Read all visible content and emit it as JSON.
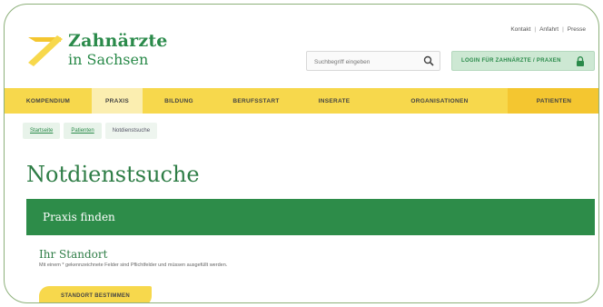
{
  "logo": {
    "title": "Zahnärzte",
    "subtitle": "in Sachsen"
  },
  "utility_links": [
    "Kontakt",
    "Anfahrt",
    "Presse"
  ],
  "search": {
    "placeholder": "Suchbegriff eingeben"
  },
  "login": {
    "label": "LOGIN FÜR ZAHNÄRZTE / PRAXEN"
  },
  "nav": {
    "items": [
      {
        "label": "KOMPENDIUM"
      },
      {
        "label": "PRAXIS"
      },
      {
        "label": "BILDUNG"
      },
      {
        "label": "BERUFSSTART"
      },
      {
        "label": "INSERATE"
      },
      {
        "label": "ORGANISATIONEN"
      },
      {
        "label": "PATIENTEN"
      }
    ],
    "active_index": 1,
    "highlight_index": 6
  },
  "breadcrumb": [
    "Startseite",
    "Patienten",
    "Notdienstsuche"
  ],
  "page": {
    "title": "Notdienstsuche"
  },
  "panel": {
    "title": "Praxis finden"
  },
  "location": {
    "title": "Ihr Standort",
    "note": "Mit einem * gekennzeichnete Felder sind Pflichtfelder und müssen ausgefüllt werden.",
    "button_label": "STANDORT BESTIMMEN"
  },
  "colors": {
    "brand_green": "#2d8c49",
    "nav_yellow": "#f7d84c",
    "login_bg": "#cde8d3"
  },
  "icons": {
    "search": "search-icon",
    "lock": "lock-icon",
    "logo": "logo-mark"
  }
}
